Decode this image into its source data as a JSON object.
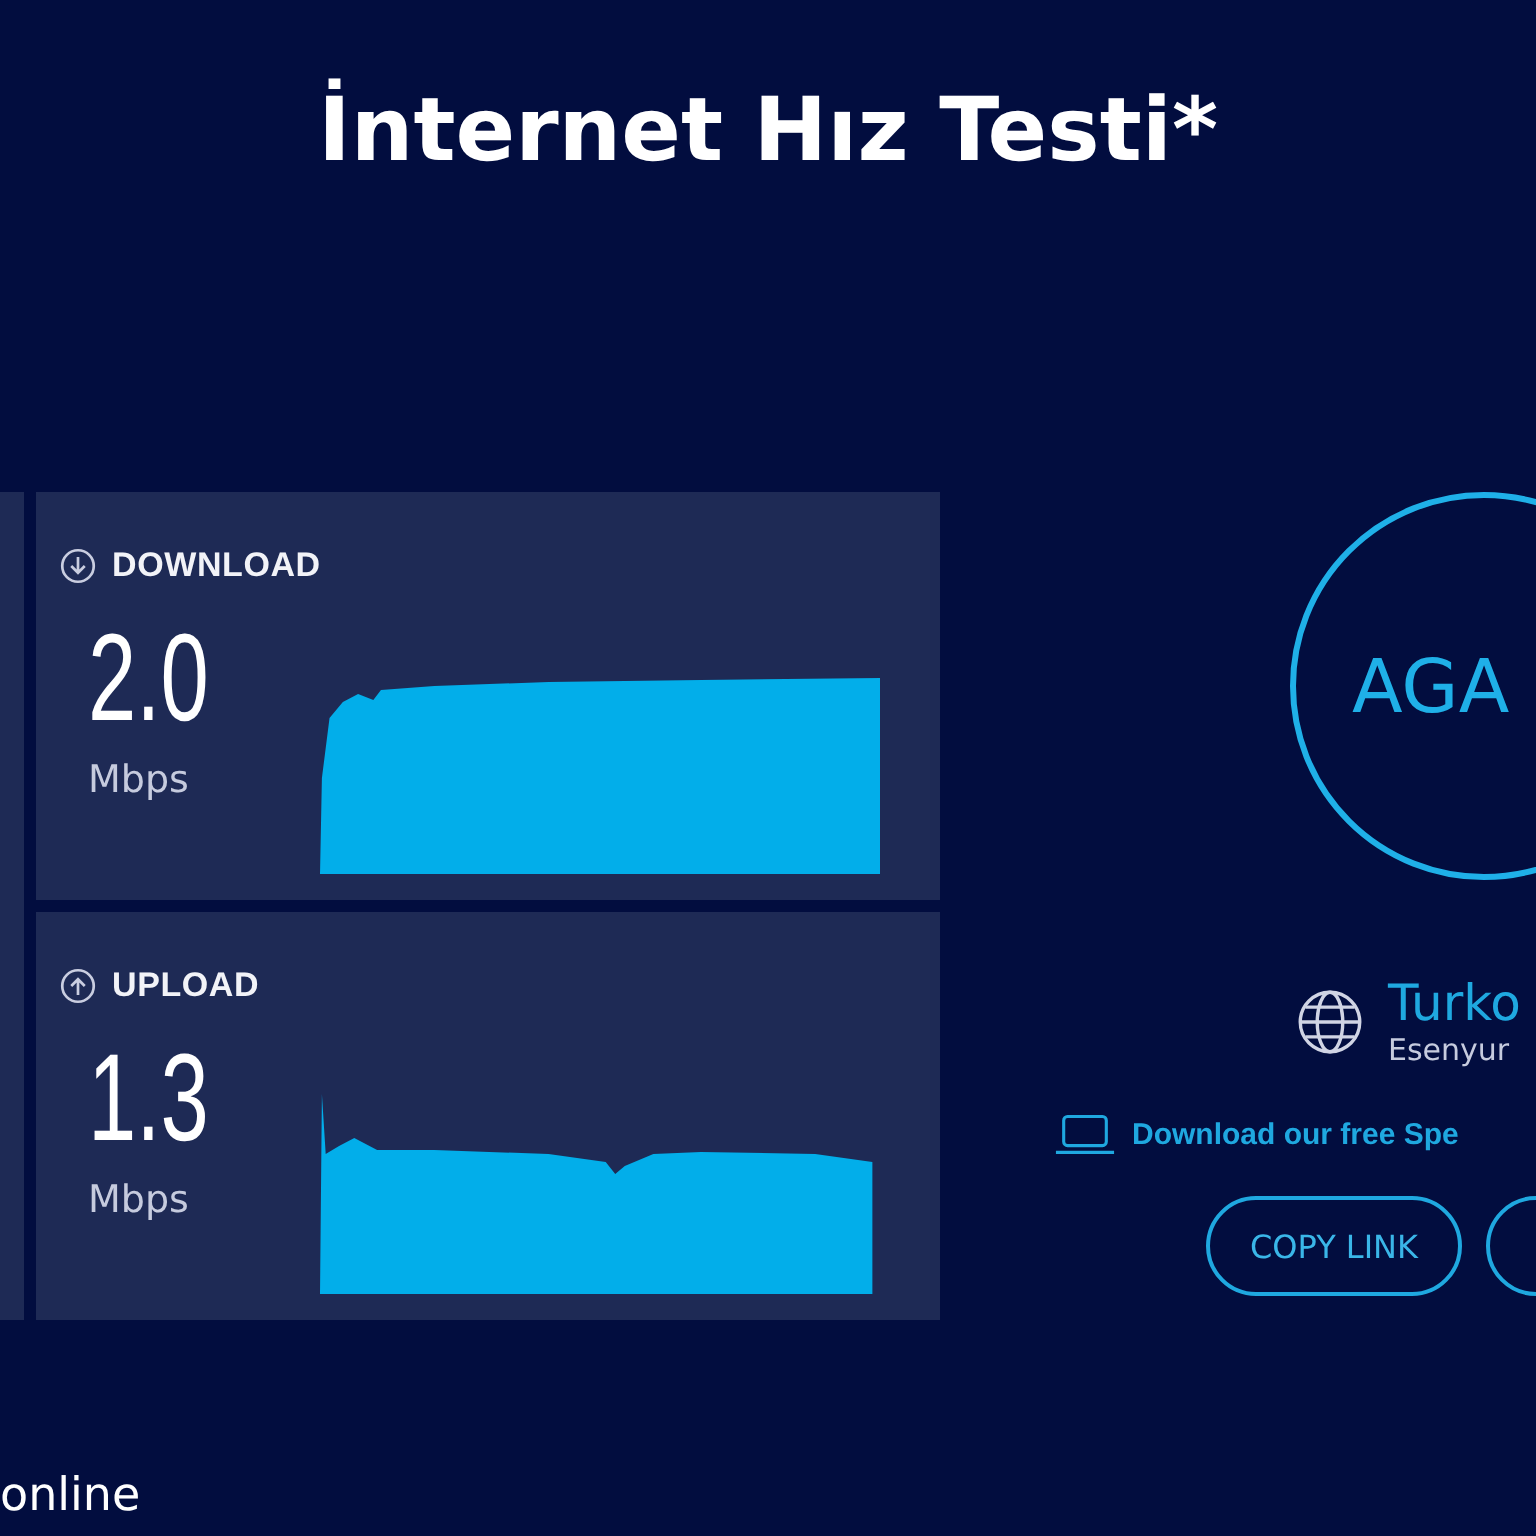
{
  "title": "İnternet Hız Testi*",
  "results": [
    {
      "kind": "download",
      "label": "DOWNLOAD",
      "value": "2.0",
      "unit": "Mbps"
    },
    {
      "kind": "upload",
      "label": "UPLOAD",
      "value": "1.3",
      "unit": "Mbps"
    }
  ],
  "go_button": {
    "label": "AGA"
  },
  "server": {
    "name": "Turko",
    "location": "Esenyur"
  },
  "app_link": "Download our free Spe",
  "buttons": [
    "COPY LINK"
  ],
  "footer_text": "online"
}
